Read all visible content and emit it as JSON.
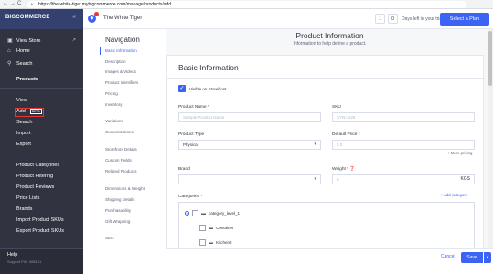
{
  "browser": {
    "back": "←",
    "forward": "→",
    "reload": "C",
    "url": "https://the-white-tiger.mybigcommerce.com/manage/products/add"
  },
  "sidebar": {
    "logo": "BIGCOMMERCE",
    "collapse": "«",
    "top_items": [
      {
        "label": "View Store",
        "icon": "external-icon"
      },
      {
        "label": "Home",
        "icon": "home-icon"
      },
      {
        "label": "Search",
        "icon": "search-icon"
      }
    ],
    "section_title": "Products",
    "sub_items": [
      "View",
      "Add",
      "Search",
      "Import",
      "Export"
    ],
    "add_badge": "BETA",
    "sub_items2": [
      "Product Categories",
      "Product Filtering",
      "Product Reviews",
      "Price Lists",
      "Brands",
      "Import Product SKUs",
      "Export Product SKUs"
    ],
    "help": "Help",
    "support": "Support PIN: 386141"
  },
  "topbar": {
    "store_name": "The White Tiger",
    "trial_digits": [
      "1",
      "0"
    ],
    "trial_text": "Days left in your trial.",
    "plan_button": "Select a Plan"
  },
  "page_nav": {
    "title": "Navigation",
    "links": [
      "Basic Information",
      "Description",
      "Images & Videos",
      "Product Identifiers",
      "Pricing",
      "Inventory",
      "Variations",
      "Customizations",
      "Storefront Details",
      "Custom Fields",
      "Related Products",
      "Dimensions & Weight",
      "Shipping Details",
      "Purchasability",
      "Gift Wrapping",
      "SEO"
    ]
  },
  "header": {
    "title": "Product Information",
    "subtitle": "Information to help define a product."
  },
  "basic_info": {
    "title": "Basic Information",
    "visible_label": "Visible on Storefront",
    "visible_checked": true,
    "product_name_label": "Product Name *",
    "product_name_placeholder": "Sample Product Name",
    "sku_label": "SKU",
    "sku_placeholder": "SYN-1128",
    "product_type_label": "Product Type",
    "product_type_value": "Physical",
    "default_price_label": "Default Price *",
    "default_price_value": "$ 0",
    "more_pricing": "More pricing",
    "brand_label": "Brand",
    "weight_label": "Weight *",
    "weight_value": "0",
    "weight_unit": "KGS",
    "categories_label": "Categories *",
    "add_category": "+ Add category",
    "categories": [
      "category_level_1",
      "Container",
      "Kitchen2"
    ]
  },
  "footer": {
    "cancel": "Cancel",
    "save": "Save",
    "caret": "▼"
  },
  "colors": {
    "accent": "#3c64f4",
    "sidebar": "#313440",
    "sidebar_header": "#34406e",
    "highlight_box": "#e53935"
  }
}
